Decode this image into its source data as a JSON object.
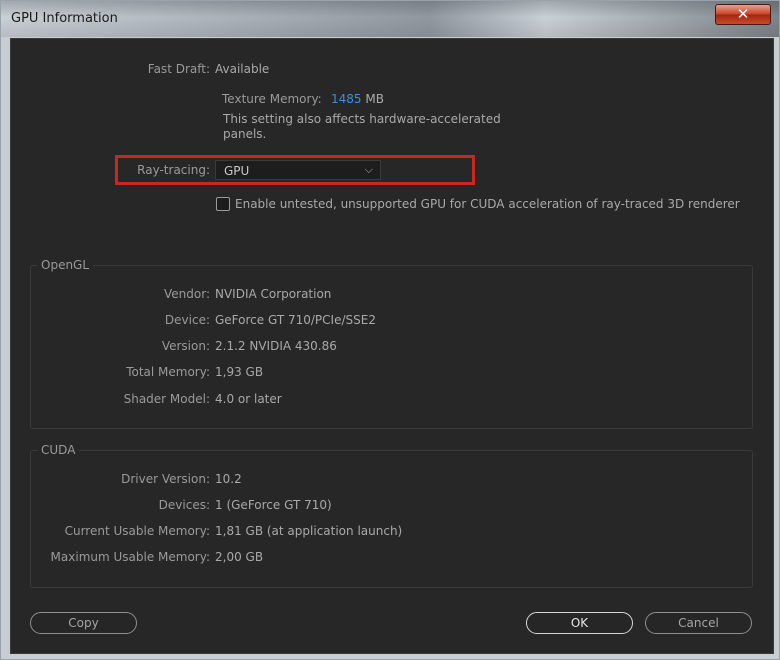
{
  "window": {
    "title": "GPU Information",
    "close_label": "✕"
  },
  "general": {
    "fast_draft_label": "Fast Draft:",
    "fast_draft_value": "Available",
    "texture_memory_label": "Texture Memory:",
    "texture_memory_value": "1485",
    "texture_memory_unit": "MB",
    "note_line1": "This setting also affects hardware-accelerated",
    "note_line2": "panels.",
    "raytracing_label": "Ray-tracing:",
    "raytracing_value": "GPU",
    "untested_label": "Enable untested, unsupported GPU for CUDA acceleration of ray-traced 3D renderer",
    "untested_checked": false
  },
  "opengl": {
    "title": "OpenGL",
    "rows": [
      {
        "label": "Vendor:",
        "value": "NVIDIA Corporation"
      },
      {
        "label": "Device:",
        "value": "GeForce GT 710/PCIe/SSE2"
      },
      {
        "label": "Version:",
        "value": "2.1.2 NVIDIA 430.86"
      },
      {
        "label": "Total Memory:",
        "value": "1,93 GB"
      },
      {
        "label": "Shader Model:",
        "value": "4.0 or later"
      }
    ]
  },
  "cuda": {
    "title": "CUDA",
    "rows": [
      {
        "label": "Driver Version:",
        "value": "10.2"
      },
      {
        "label": "Devices:",
        "value": "1 (GeForce GT 710)"
      },
      {
        "label": "Current Usable Memory:",
        "value": "1,81 GB (at application launch)"
      },
      {
        "label": "Maximum Usable Memory:",
        "value": "2,00 GB"
      }
    ]
  },
  "buttons": {
    "copy": "Copy",
    "ok": "OK",
    "cancel": "Cancel"
  }
}
